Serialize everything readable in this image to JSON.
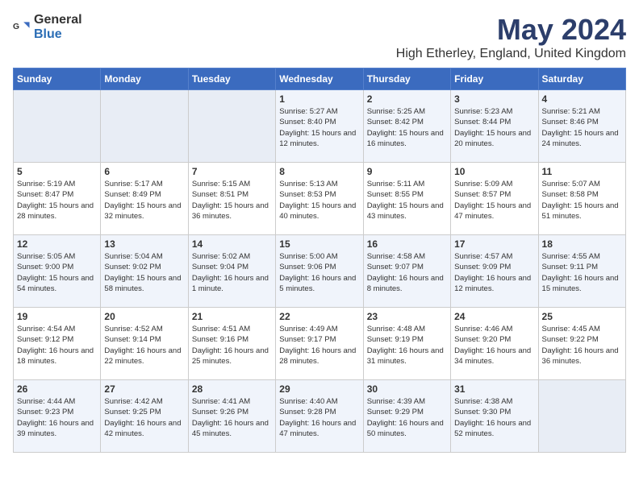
{
  "header": {
    "logo_general": "General",
    "logo_blue": "Blue",
    "title": "May 2024",
    "subtitle": "High Etherley, England, United Kingdom"
  },
  "weekdays": [
    "Sunday",
    "Monday",
    "Tuesday",
    "Wednesday",
    "Thursday",
    "Friday",
    "Saturday"
  ],
  "weeks": [
    [
      {
        "day": "",
        "info": ""
      },
      {
        "day": "",
        "info": ""
      },
      {
        "day": "",
        "info": ""
      },
      {
        "day": "1",
        "info": "Sunrise: 5:27 AM\nSunset: 8:40 PM\nDaylight: 15 hours\nand 12 minutes."
      },
      {
        "day": "2",
        "info": "Sunrise: 5:25 AM\nSunset: 8:42 PM\nDaylight: 15 hours\nand 16 minutes."
      },
      {
        "day": "3",
        "info": "Sunrise: 5:23 AM\nSunset: 8:44 PM\nDaylight: 15 hours\nand 20 minutes."
      },
      {
        "day": "4",
        "info": "Sunrise: 5:21 AM\nSunset: 8:46 PM\nDaylight: 15 hours\nand 24 minutes."
      }
    ],
    [
      {
        "day": "5",
        "info": "Sunrise: 5:19 AM\nSunset: 8:47 PM\nDaylight: 15 hours\nand 28 minutes."
      },
      {
        "day": "6",
        "info": "Sunrise: 5:17 AM\nSunset: 8:49 PM\nDaylight: 15 hours\nand 32 minutes."
      },
      {
        "day": "7",
        "info": "Sunrise: 5:15 AM\nSunset: 8:51 PM\nDaylight: 15 hours\nand 36 minutes."
      },
      {
        "day": "8",
        "info": "Sunrise: 5:13 AM\nSunset: 8:53 PM\nDaylight: 15 hours\nand 40 minutes."
      },
      {
        "day": "9",
        "info": "Sunrise: 5:11 AM\nSunset: 8:55 PM\nDaylight: 15 hours\nand 43 minutes."
      },
      {
        "day": "10",
        "info": "Sunrise: 5:09 AM\nSunset: 8:57 PM\nDaylight: 15 hours\nand 47 minutes."
      },
      {
        "day": "11",
        "info": "Sunrise: 5:07 AM\nSunset: 8:58 PM\nDaylight: 15 hours\nand 51 minutes."
      }
    ],
    [
      {
        "day": "12",
        "info": "Sunrise: 5:05 AM\nSunset: 9:00 PM\nDaylight: 15 hours\nand 54 minutes."
      },
      {
        "day": "13",
        "info": "Sunrise: 5:04 AM\nSunset: 9:02 PM\nDaylight: 15 hours\nand 58 minutes."
      },
      {
        "day": "14",
        "info": "Sunrise: 5:02 AM\nSunset: 9:04 PM\nDaylight: 16 hours\nand 1 minute."
      },
      {
        "day": "15",
        "info": "Sunrise: 5:00 AM\nSunset: 9:06 PM\nDaylight: 16 hours\nand 5 minutes."
      },
      {
        "day": "16",
        "info": "Sunrise: 4:58 AM\nSunset: 9:07 PM\nDaylight: 16 hours\nand 8 minutes."
      },
      {
        "day": "17",
        "info": "Sunrise: 4:57 AM\nSunset: 9:09 PM\nDaylight: 16 hours\nand 12 minutes."
      },
      {
        "day": "18",
        "info": "Sunrise: 4:55 AM\nSunset: 9:11 PM\nDaylight: 16 hours\nand 15 minutes."
      }
    ],
    [
      {
        "day": "19",
        "info": "Sunrise: 4:54 AM\nSunset: 9:12 PM\nDaylight: 16 hours\nand 18 minutes."
      },
      {
        "day": "20",
        "info": "Sunrise: 4:52 AM\nSunset: 9:14 PM\nDaylight: 16 hours\nand 22 minutes."
      },
      {
        "day": "21",
        "info": "Sunrise: 4:51 AM\nSunset: 9:16 PM\nDaylight: 16 hours\nand 25 minutes."
      },
      {
        "day": "22",
        "info": "Sunrise: 4:49 AM\nSunset: 9:17 PM\nDaylight: 16 hours\nand 28 minutes."
      },
      {
        "day": "23",
        "info": "Sunrise: 4:48 AM\nSunset: 9:19 PM\nDaylight: 16 hours\nand 31 minutes."
      },
      {
        "day": "24",
        "info": "Sunrise: 4:46 AM\nSunset: 9:20 PM\nDaylight: 16 hours\nand 34 minutes."
      },
      {
        "day": "25",
        "info": "Sunrise: 4:45 AM\nSunset: 9:22 PM\nDaylight: 16 hours\nand 36 minutes."
      }
    ],
    [
      {
        "day": "26",
        "info": "Sunrise: 4:44 AM\nSunset: 9:23 PM\nDaylight: 16 hours\nand 39 minutes."
      },
      {
        "day": "27",
        "info": "Sunrise: 4:42 AM\nSunset: 9:25 PM\nDaylight: 16 hours\nand 42 minutes."
      },
      {
        "day": "28",
        "info": "Sunrise: 4:41 AM\nSunset: 9:26 PM\nDaylight: 16 hours\nand 45 minutes."
      },
      {
        "day": "29",
        "info": "Sunrise: 4:40 AM\nSunset: 9:28 PM\nDaylight: 16 hours\nand 47 minutes."
      },
      {
        "day": "30",
        "info": "Sunrise: 4:39 AM\nSunset: 9:29 PM\nDaylight: 16 hours\nand 50 minutes."
      },
      {
        "day": "31",
        "info": "Sunrise: 4:38 AM\nSunset: 9:30 PM\nDaylight: 16 hours\nand 52 minutes."
      },
      {
        "day": "",
        "info": ""
      }
    ]
  ]
}
